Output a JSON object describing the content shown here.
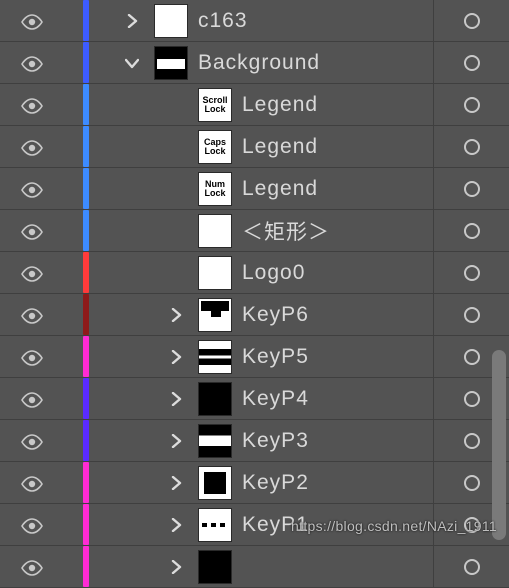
{
  "colors": {
    "blue": "#3d5cff",
    "lightblue": "#3d8bff",
    "red": "#ff3b3b",
    "darkred": "#8e1a1a",
    "magenta": "#ff2bd4",
    "purple": "#5a2bff",
    "pink": "#ff2bd4"
  },
  "watermark": "https://blog.csdn.net/NAzi_1911",
  "layers": [
    {
      "visible": true,
      "color": "blue",
      "indent": 1,
      "expand": "right",
      "thumbType": "white",
      "thumbText": "",
      "name": "c163"
    },
    {
      "visible": true,
      "color": "blue",
      "indent": 1,
      "expand": "down",
      "thumbType": "kbd",
      "thumbText": "",
      "name": "Background"
    },
    {
      "visible": true,
      "color": "lightblue",
      "indent": 2,
      "expand": "none",
      "thumbType": "text",
      "thumbText": "Scroll\nLock",
      "name": "Legend"
    },
    {
      "visible": true,
      "color": "lightblue",
      "indent": 2,
      "expand": "none",
      "thumbType": "text",
      "thumbText": "Caps\nLock",
      "name": "Legend"
    },
    {
      "visible": true,
      "color": "lightblue",
      "indent": 2,
      "expand": "none",
      "thumbType": "text",
      "thumbText": "Num\nLock",
      "name": "Legend"
    },
    {
      "visible": true,
      "color": "lightblue",
      "indent": 2,
      "expand": "none",
      "thumbType": "white",
      "thumbText": "",
      "name": "＜矩形＞"
    },
    {
      "visible": true,
      "color": "red",
      "indent": 2,
      "expand": "none",
      "thumbType": "white",
      "thumbText": "",
      "name": "Logo0"
    },
    {
      "visible": true,
      "color": "darkred",
      "indent": 2,
      "expand": "right",
      "thumbType": "tshape",
      "thumbText": "",
      "name": "KeyP6"
    },
    {
      "visible": true,
      "color": "magenta",
      "indent": 2,
      "expand": "right",
      "thumbType": "stripes2",
      "thumbText": "",
      "name": "KeyP5"
    },
    {
      "visible": true,
      "color": "purple",
      "indent": 2,
      "expand": "right",
      "thumbType": "black",
      "thumbText": "",
      "name": "KeyP4"
    },
    {
      "visible": true,
      "color": "purple",
      "indent": 2,
      "expand": "right",
      "thumbType": "stripes",
      "thumbText": "",
      "name": "KeyP3"
    },
    {
      "visible": true,
      "color": "pink",
      "indent": 2,
      "expand": "right",
      "thumbType": "blackbox",
      "thumbText": "",
      "name": "KeyP2"
    },
    {
      "visible": true,
      "color": "pink",
      "indent": 2,
      "expand": "right",
      "thumbType": "dash",
      "thumbText": "",
      "name": "KeyP1"
    },
    {
      "visible": true,
      "color": "pink",
      "indent": 2,
      "expand": "right",
      "thumbType": "black",
      "thumbText": "",
      "name": ""
    }
  ]
}
